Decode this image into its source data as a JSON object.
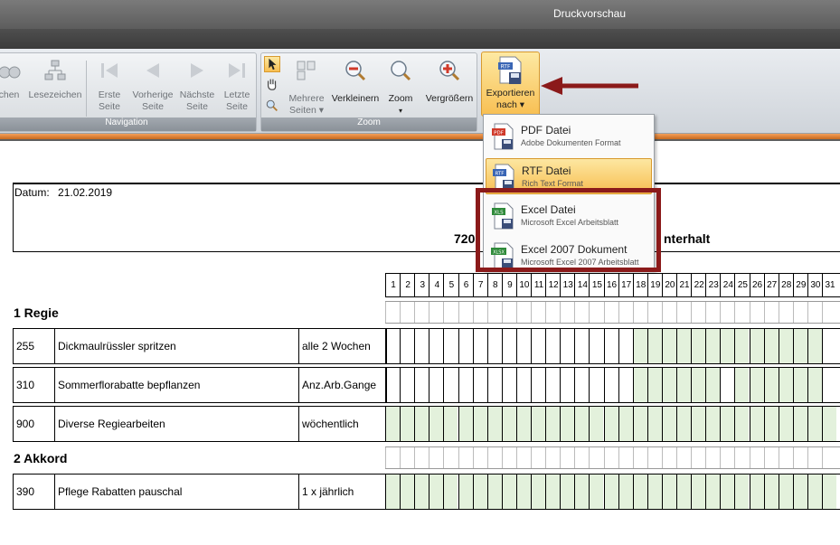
{
  "window": {
    "title": "Druckvorschau"
  },
  "ribbon": {
    "navigation": {
      "label": "Navigation",
      "buttons": [
        {
          "label1": "chen",
          "label2": "",
          "icon": "binoculars-icon"
        },
        {
          "label1": "Lesezeichen",
          "label2": "",
          "icon": "bookmarks-tree-icon"
        },
        {
          "label1": "Erste",
          "label2": "Seite",
          "icon": "first-page-icon"
        },
        {
          "label1": "Vorherige",
          "label2": "Seite",
          "icon": "previous-page-icon"
        },
        {
          "label1": "Nächste",
          "label2": "Seite",
          "icon": "next-page-icon"
        },
        {
          "label1": "Letzte",
          "label2": "Seite",
          "icon": "last-page-icon"
        }
      ]
    },
    "zoom": {
      "label": "Zoom",
      "multi_pages": {
        "label1": "Mehrere",
        "label2": "Seiten ▾"
      },
      "shrink": {
        "label": "Verkleinern"
      },
      "zoom": {
        "label": "Zoom",
        "arrow": "▾"
      },
      "enlarge": {
        "label": "Vergrößern"
      }
    },
    "export": {
      "label1": "Exportieren",
      "label2": "nach ▾"
    }
  },
  "export_menu": [
    {
      "title": "PDF Datei",
      "subtitle": "Adobe Dokumenten Format",
      "badge": "PDF",
      "color": "#d03a2a"
    },
    {
      "title": "RTF Datei",
      "subtitle": "Rich Text Format",
      "badge": "RTF",
      "color": "#3a66b5"
    },
    {
      "title": "Excel Datei",
      "subtitle": "Microsoft Excel Arbeitsblatt",
      "badge": "XLS",
      "color": "#2f8a3a"
    },
    {
      "title": "Excel 2007 Dokument",
      "subtitle": "Microsoft Excel 2007 Arbeitsblatt",
      "badge": "XLSX",
      "color": "#2f8a3a"
    }
  ],
  "document": {
    "datum_label": "Datum:",
    "datum_value": "21.02.2019",
    "title_left": "720",
    "title_right": "nterhalt",
    "days": [
      "1",
      "2",
      "3",
      "4",
      "5",
      "6",
      "7",
      "8",
      "9",
      "10",
      "11",
      "12",
      "13",
      "14",
      "15",
      "16",
      "17",
      "18",
      "19",
      "20",
      "21",
      "22",
      "23",
      "24",
      "25",
      "26",
      "27",
      "28",
      "29",
      "30",
      "31"
    ],
    "sections": [
      {
        "name": "1 Regie"
      },
      {
        "name": "2 Akkord"
      }
    ],
    "rows": [
      {
        "nr": "255",
        "task": "Dickmaulrüssler spritzen",
        "freq": "alle 2 Wochen"
      },
      {
        "nr": "310",
        "task": "Sommerflorabatte bepflanzen",
        "freq": "Anz.Arb.Gange"
      },
      {
        "nr": "900",
        "task": "Diverse Regiearbeiten",
        "freq": "wöchentlich"
      },
      {
        "nr": "390",
        "task": "Pflege Rabatten pauschal",
        "freq": "1 x jährlich"
      }
    ]
  },
  "colors": {
    "highlight_green": "#e3f1dc",
    "accent_orange": "#f7be52",
    "annotation_red": "#8b1a1a"
  }
}
